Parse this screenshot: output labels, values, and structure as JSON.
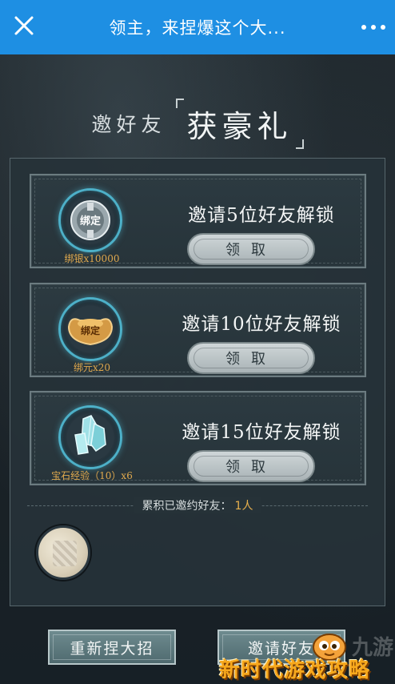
{
  "topbar": {
    "title": "领主，来捏爆这个大...",
    "close_icon": "close-icon",
    "more_icon": "more-dots-icon",
    "color": "#1e8fe3"
  },
  "heading": {
    "prefix": "邀好友",
    "main": "获豪礼"
  },
  "rewards": [
    {
      "unlock_text": "邀请5位好友解锁",
      "reward_label": "绑银x10000",
      "icon": "bound-silver-coin-icon",
      "icon_text": "绑定",
      "claim_label": "领取"
    },
    {
      "unlock_text": "邀请10位好友解锁",
      "reward_label": "绑元x20",
      "icon": "bound-ingot-icon",
      "icon_text": "绑定",
      "claim_label": "领取"
    },
    {
      "unlock_text": "邀请15位好友解锁",
      "reward_label": "宝石经验（10）x6",
      "icon": "gem-crystal-icon",
      "claim_label": "领取"
    }
  ],
  "invited": {
    "label": "累积已邀约好友：",
    "count": "1人"
  },
  "avatar": {
    "icon": "friend-avatar"
  },
  "bottom": {
    "left_label": "重新捏大招",
    "right_label": "邀请好友"
  },
  "watermark": {
    "text": "新时代游戏攻略",
    "faint": "九游"
  },
  "colors": {
    "accent_gold": "#e0a94e",
    "count_gold": "#e8b04d",
    "ring_cyan": "#4db0c8"
  }
}
